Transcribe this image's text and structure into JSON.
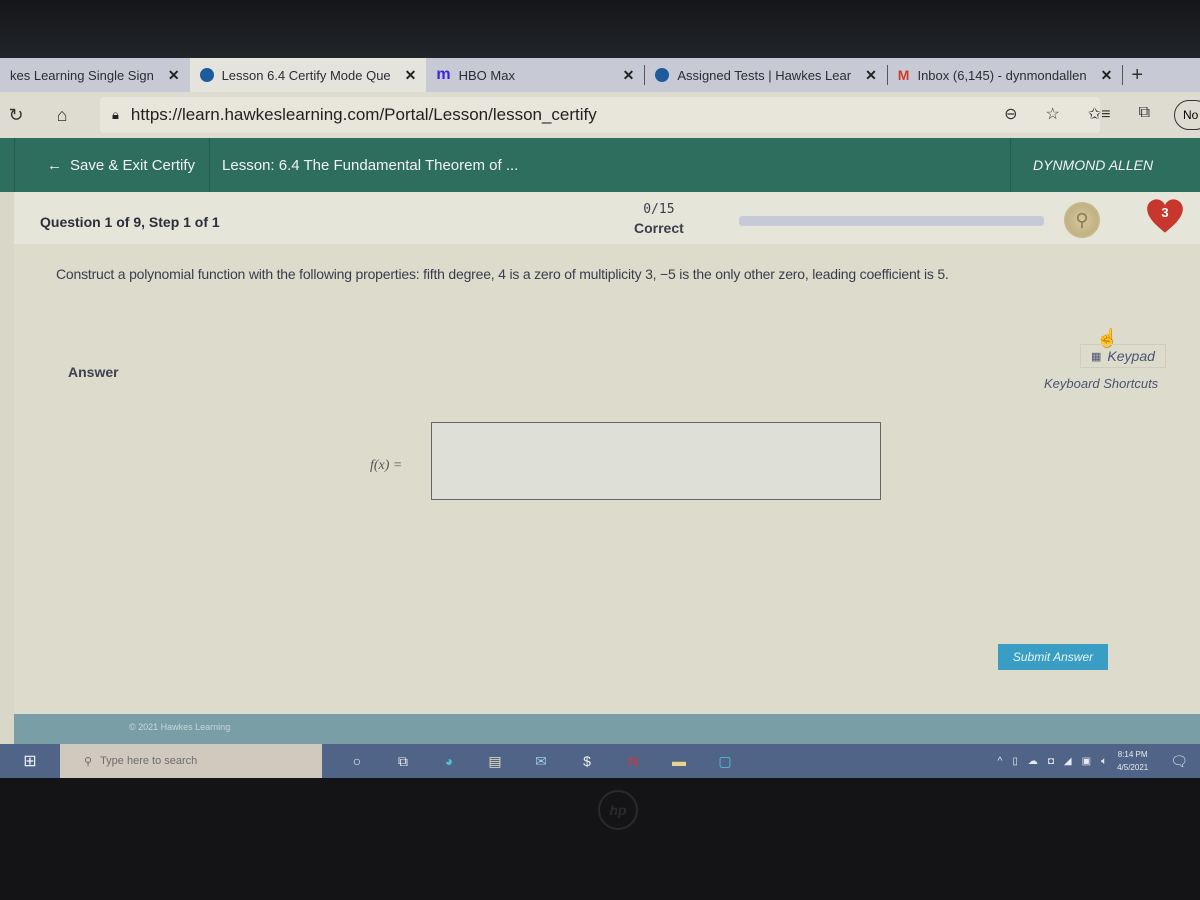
{
  "browser": {
    "tabs": [
      {
        "label": "kes Learning Single Sign",
        "icon": "hawkes-icon",
        "active": false
      },
      {
        "label": "Lesson 6.4 Certify Mode Que",
        "icon": "hawkes-icon",
        "active": true
      },
      {
        "label": "HBO Max",
        "icon": "hbo-max-icon",
        "active": false
      },
      {
        "label": "Assigned Tests | Hawkes Lear",
        "icon": "hawkes-icon",
        "active": false
      },
      {
        "label": "Inbox (6,145) - dynmondallen",
        "icon": "gmail-icon",
        "active": false
      }
    ],
    "close_glyph": "✕",
    "new_tab_glyph": "+",
    "url": "https://learn.hawkeslearning.com/Portal/Lesson/lesson_certify",
    "profile_label": "No"
  },
  "app": {
    "save_exit_label": "Save & Exit Certify",
    "lesson_title": "Lesson: 6.4 The Fundamental Theorem of ...",
    "user_name": "DYNMOND ALLEN",
    "question_label": "Question 1 of 9, Step 1 of 1",
    "score": "0/15",
    "score_label": "Correct",
    "progress_fraction": 0,
    "lives": "3",
    "question_text": "Construct a polynomial function with the following properties: fifth degree, 4 is a zero of multiplicity 3, −5 is the only other zero, leading coefficient is 5.",
    "answer_label": "Answer",
    "keypad_label": "Keypad",
    "keyboard_shortcuts_label": "Keyboard Shortcuts",
    "fx_label": "f(x) =",
    "fx_value": "",
    "submit_label": "Submit Answer",
    "copyright": "© 2021 Hawkes Learning"
  },
  "taskbar": {
    "search_placeholder": "Type here to search",
    "time": "8:14 PM",
    "date": "4/5/2021"
  },
  "colors": {
    "header_green": "#2e6e5e",
    "submit_blue": "#3a9ec4",
    "heart_red": "#c8372d"
  }
}
